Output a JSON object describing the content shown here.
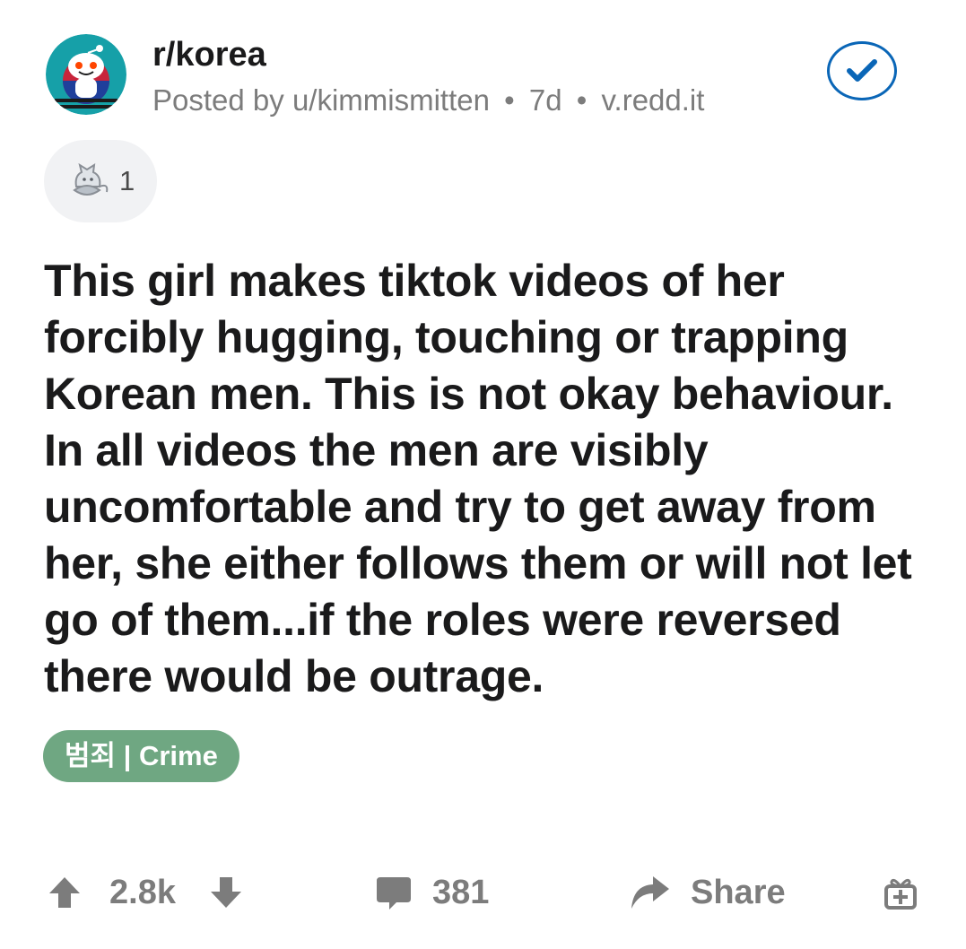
{
  "post": {
    "subreddit": "r/korea",
    "posted_by_prefix": "Posted by",
    "author": "u/kimmismitten",
    "age": "7d",
    "domain": "v.redd.it",
    "separator": "•",
    "award_count": "1",
    "title": "This girl makes tiktok videos of her forcibly hugging, touching or trapping Korean men. This is not okay behaviour. In all videos the men are visibly uncomfortable and try to get away from her, she either follows them or will not let go of them...if the roles were reversed there would be outrage.",
    "flair": "범죄 | Crime"
  },
  "actions": {
    "score": "2.8k",
    "comments": "381",
    "share_label": "Share"
  },
  "icons": {
    "avatar": "subreddit-korea-snoo-icon",
    "join": "check-icon",
    "award": "award-icon",
    "upvote": "upvote-arrow-icon",
    "downvote": "downvote-arrow-icon",
    "comments": "comment-bubble-icon",
    "share": "share-arrow-icon",
    "gift": "gift-icon"
  },
  "colors": {
    "accent_blue": "#0a66b7",
    "flair_green": "#6fa782",
    "muted_text": "#7c7c7c",
    "title_text": "#1a1a1b"
  }
}
